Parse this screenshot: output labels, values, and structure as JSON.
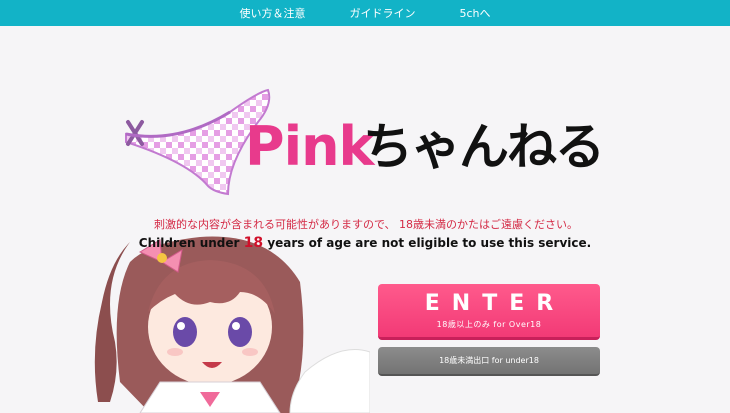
{
  "nav": {
    "items": [
      {
        "label": "使い方＆注意"
      },
      {
        "label": "ガイドライン"
      },
      {
        "label": "5chへ"
      }
    ]
  },
  "logo": {
    "text_en": "Pink",
    "text_jp": "ちゃんねる",
    "icon": "panties-icon"
  },
  "notice": {
    "jp": "刺激的な内容が含まれる可能性がありますので、 18歳未満のかたはご遠慮ください。",
    "en_before": "Children under",
    "en_age": "18",
    "en_after": "years of age are not eligible to use this service."
  },
  "buttons": {
    "enter_label": "ENTER",
    "enter_sub": "18歳以上のみ  for Over18",
    "under_label": "18歳未満出口  for under18"
  },
  "colors": {
    "nav_bg": "#12b3c7",
    "brand_pink": "#e83a8c",
    "enter_bg": "#f23a76",
    "under_bg": "#7f7f7f",
    "warning_red": "#d42a45"
  }
}
